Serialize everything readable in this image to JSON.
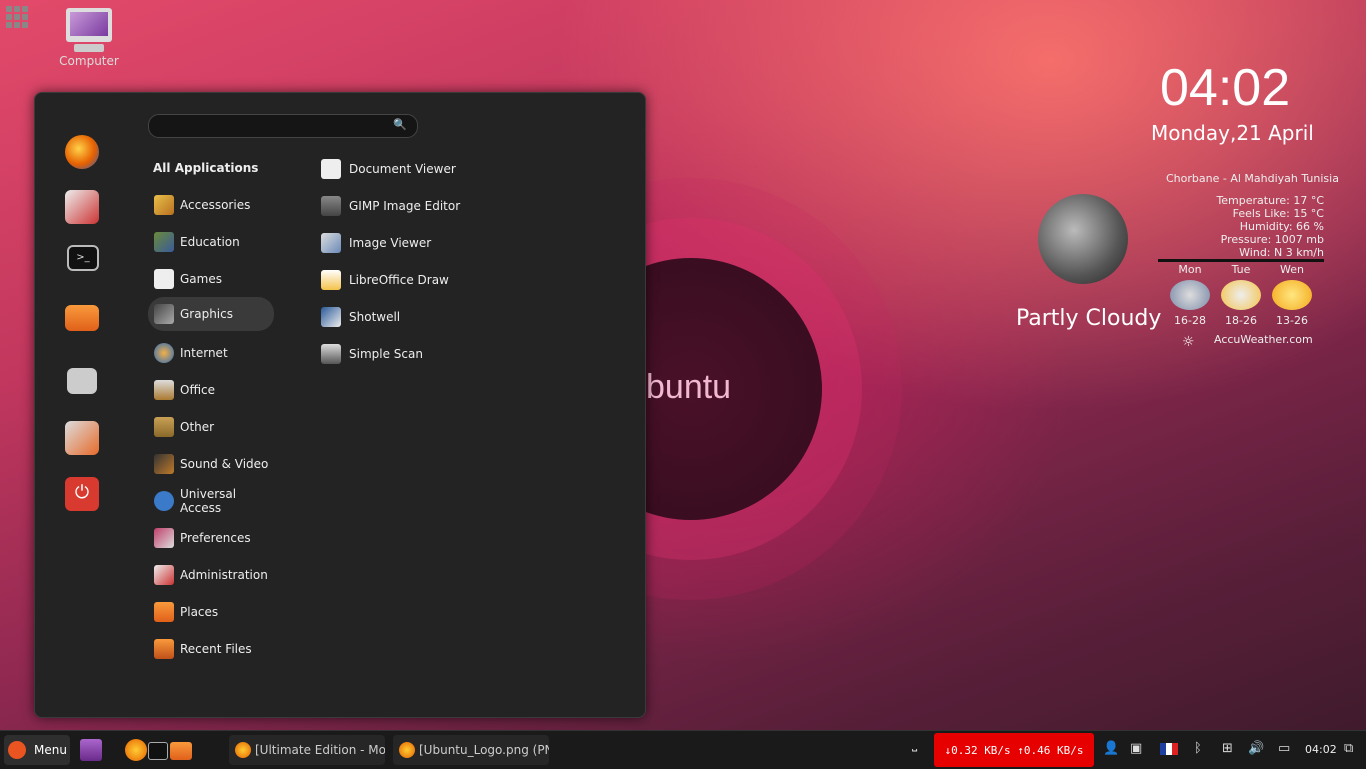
{
  "desktop": {
    "computer_label": "Computer",
    "wallpaper_logo": "ubuntu"
  },
  "menu": {
    "search": {
      "value": "",
      "placeholder": ""
    },
    "favorites": [
      "firefox-icon",
      "system-settings-icon",
      "terminal-icon",
      "home-folder-icon",
      "lock-screen-icon",
      "logout-icon",
      "power-icon"
    ],
    "categories": [
      {
        "label": "All Applications",
        "icon": "",
        "selected": false
      },
      {
        "label": "Accessories",
        "icon": "accessories-icon"
      },
      {
        "label": "Education",
        "icon": "education-icon"
      },
      {
        "label": "Games",
        "icon": "games-icon"
      },
      {
        "label": "Graphics",
        "icon": "graphics-icon",
        "selected": true
      },
      {
        "label": "Internet",
        "icon": "internet-icon"
      },
      {
        "label": "Office",
        "icon": "office-icon"
      },
      {
        "label": "Other",
        "icon": "other-icon"
      },
      {
        "label": "Sound & Video",
        "icon": "sound-video-icon"
      },
      {
        "label": "Universal Access",
        "icon": "universal-access-icon"
      },
      {
        "label": "Preferences",
        "icon": "preferences-icon"
      },
      {
        "label": "Administration",
        "icon": "administration-icon"
      },
      {
        "label": "Places",
        "icon": "places-icon"
      },
      {
        "label": "Recent Files",
        "icon": "recent-files-icon"
      }
    ],
    "apps": [
      {
        "label": "Document Viewer",
        "icon": "document-viewer-icon"
      },
      {
        "label": "GIMP Image Editor",
        "icon": "gimp-icon"
      },
      {
        "label": "Image Viewer",
        "icon": "image-viewer-icon"
      },
      {
        "label": "LibreOffice Draw",
        "icon": "libreoffice-draw-icon"
      },
      {
        "label": "Shotwell",
        "icon": "shotwell-icon"
      },
      {
        "label": "Simple Scan",
        "icon": "simple-scan-icon"
      }
    ]
  },
  "clock": {
    "time": "04:02",
    "date": "Monday,21 April"
  },
  "weather": {
    "location": "Chorbane - Al Mahdiyah Tunisia",
    "lines": [
      "Temperature: 17 °C",
      "Feels Like: 15 °C",
      "Humidity: 66 %",
      "Pressure: 1007 mb",
      "Wind: N 3 km/h"
    ],
    "condition": "Partly Cloudy",
    "provider": "AccuWeather.com",
    "forecast": [
      {
        "day": "Mon",
        "range": "16-28",
        "icon": "rain-cloud-icon"
      },
      {
        "day": "Tue",
        "range": "18-26",
        "icon": "partly-cloudy-icon"
      },
      {
        "day": "Wen",
        "range": "13-26",
        "icon": "sunny-icon"
      }
    ]
  },
  "taskbar": {
    "menu_label": "Menu",
    "windows": [
      "[Ultimate Edition - Moz...",
      "[Ubuntu_Logo.png (PN..."
    ],
    "netspeed": "↓0.32 KB/s ↑0.46 KB/s",
    "clock": "04:02",
    "colors": {
      "netspeed_bg": "#e60000",
      "ubuntu_orange": "#e95420"
    }
  }
}
